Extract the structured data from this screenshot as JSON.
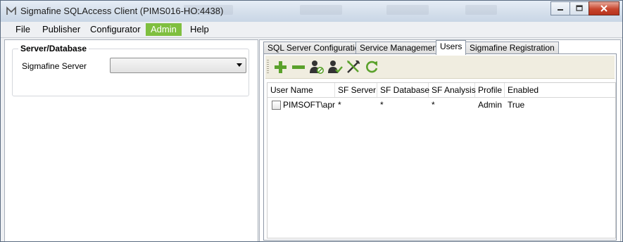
{
  "window": {
    "title": "Sigmafine SQLAccess Client (PIMS016-HO:4438)"
  },
  "menu": [
    {
      "label": "File",
      "active": false
    },
    {
      "label": "Publisher",
      "active": false
    },
    {
      "label": "Configurator",
      "active": false
    },
    {
      "label": "Admin",
      "active": true
    },
    {
      "label": "Help",
      "active": false
    }
  ],
  "server_panel": {
    "group_title": "Server/Database",
    "server_label": "Sigmafine Server",
    "server_value": ""
  },
  "tabs": [
    {
      "label": "SQL Server Configuration",
      "active": false
    },
    {
      "label": "Service Management",
      "active": false
    },
    {
      "label": "Users",
      "active": true
    },
    {
      "label": "Sigmafine Registration",
      "active": false
    }
  ],
  "toolbar": {
    "icons": [
      "add-user-icon",
      "remove-user-icon",
      "disable-user-icon",
      "enable-user-icon",
      "tools-icon",
      "refresh-icon"
    ]
  },
  "users_table": {
    "columns": [
      "User Name",
      "SF Server",
      "SF Database",
      "SF Analysis",
      "Profile",
      "Enabled"
    ],
    "rows": [
      {
        "checked": false,
        "user_name": "PIMSOFT\\apra",
        "sf_server": "*",
        "sf_database": "*",
        "sf_analysis": "*",
        "profile": "Admin",
        "enabled": "True"
      }
    ]
  },
  "colors": {
    "accent_green": "#7fbf3f",
    "icon_green": "#5aa12b",
    "toolbar_bg": "#f0ede0",
    "close_button_red": "#c7452d"
  }
}
